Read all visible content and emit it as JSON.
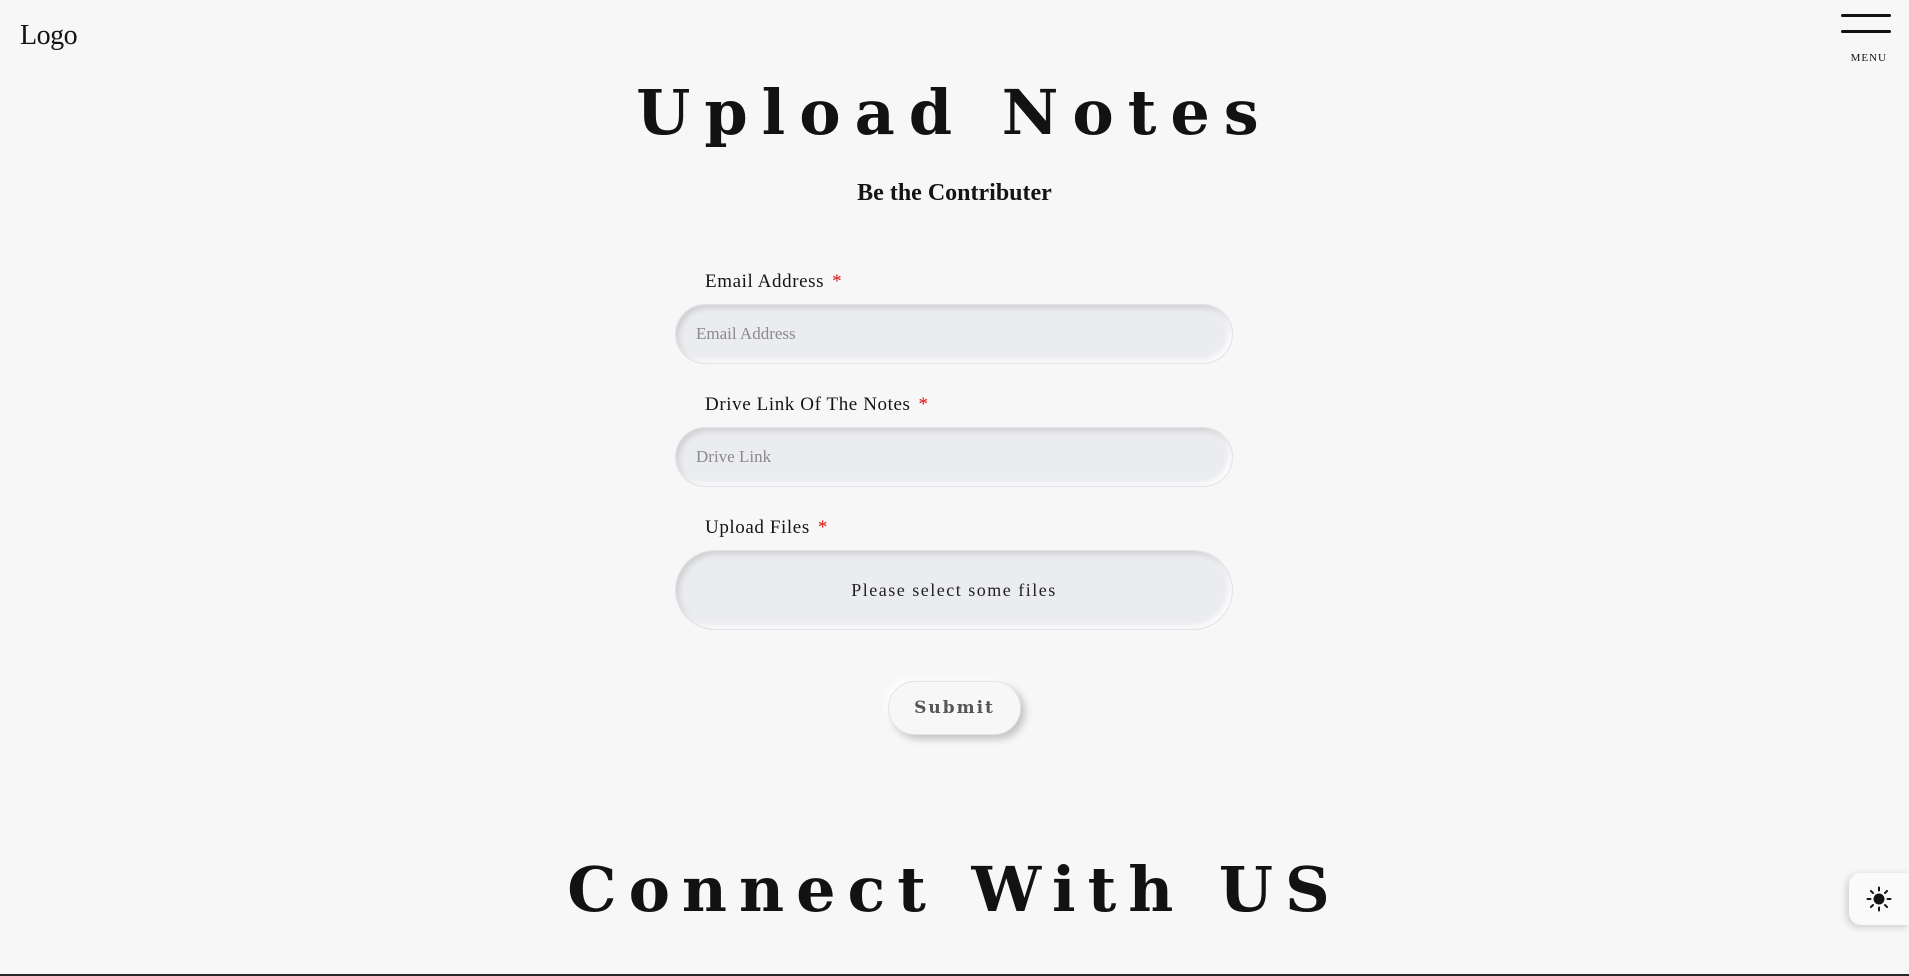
{
  "header": {
    "logo": "Logo",
    "menu_label": "MENU"
  },
  "main": {
    "title": "Upload Notes",
    "subtitle": "Be the Contributer"
  },
  "form": {
    "email": {
      "label": "Email Address",
      "required_mark": "*",
      "placeholder": "Email Address",
      "value": ""
    },
    "drive_link": {
      "label": "Drive Link Of The Notes",
      "required_mark": "*",
      "placeholder": "Drive Link",
      "value": ""
    },
    "upload": {
      "label": "Upload Files",
      "required_mark": "*",
      "prompt": "Please select some files"
    },
    "submit_label": "Submit"
  },
  "footer": {
    "connect_heading": "Connect With US"
  },
  "theme_toggle": {
    "icon": "sun-icon"
  },
  "colors": {
    "background": "#f7f7f7",
    "text": "#141414",
    "required": "#e01010",
    "input_bg": "#ebecef"
  }
}
